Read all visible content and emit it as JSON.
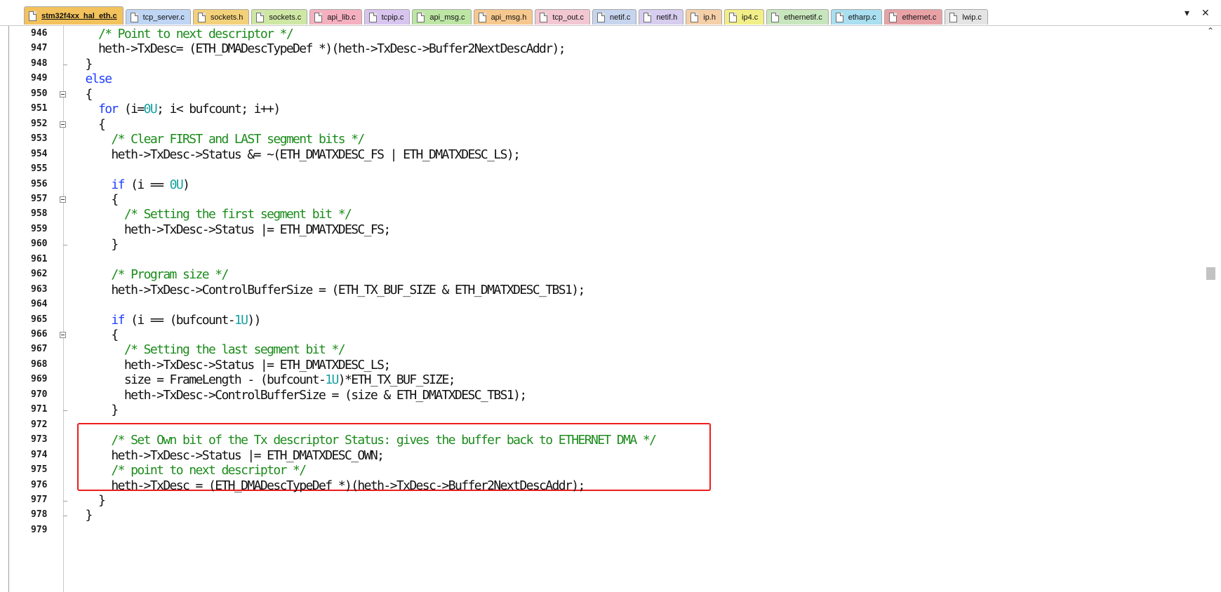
{
  "tabs": [
    {
      "label": "stm32f4xx_hal_eth.c",
      "color": "#f3c25c",
      "active": true
    },
    {
      "label": "tcp_server.c",
      "color": "#bfd5f4"
    },
    {
      "label": "sockets.h",
      "color": "#f3d17a"
    },
    {
      "label": "sockets.c",
      "color": "#cfe7a5"
    },
    {
      "label": "api_lib.c",
      "color": "#f5b0c0"
    },
    {
      "label": "tcpip.c",
      "color": "#d8c5ef"
    },
    {
      "label": "api_msg.c",
      "color": "#bde6a5"
    },
    {
      "label": "api_msg.h",
      "color": "#f6c88e"
    },
    {
      "label": "tcp_out.c",
      "color": "#f2c7d2"
    },
    {
      "label": "netif.c",
      "color": "#c6d4ee"
    },
    {
      "label": "netif.h",
      "color": "#d6cdef"
    },
    {
      "label": "ip.h",
      "color": "#f4cfa7"
    },
    {
      "label": "ip4.c",
      "color": "#f2ef88"
    },
    {
      "label": "ethernetif.c",
      "color": "#c8e6bd"
    },
    {
      "label": "etharp.c",
      "color": "#a9dff0"
    },
    {
      "label": "ethernet.c",
      "color": "#e8a2a6"
    },
    {
      "label": "lwip.c",
      "color": "#e4e4e4"
    }
  ],
  "tab_controls": {
    "dropdown": "▾",
    "close": "✕"
  },
  "scrollbar": {
    "up_arrow": "⌃"
  },
  "lines": [
    {
      "num": "946",
      "fold": "line",
      "tokens": [
        {
          "t": "    "
        },
        {
          "t": "/* Point to next descriptor */",
          "c": "cm"
        }
      ]
    },
    {
      "num": "947",
      "fold": "line",
      "tokens": [
        {
          "t": "    heth->TxDesc= (ETH_DMADescTypeDef *)(heth->TxDesc->Buffer2NextDescAddr);"
        }
      ]
    },
    {
      "num": "948",
      "fold": "tick",
      "tokens": [
        {
          "t": "  }"
        }
      ]
    },
    {
      "num": "949",
      "fold": "line",
      "tokens": [
        {
          "t": "  "
        },
        {
          "t": "else",
          "c": "kw"
        }
      ]
    },
    {
      "num": "950",
      "fold": "box",
      "tokens": [
        {
          "t": "  {"
        }
      ]
    },
    {
      "num": "951",
      "fold": "line",
      "tokens": [
        {
          "t": "    "
        },
        {
          "t": "for",
          "c": "kw"
        },
        {
          "t": " (i="
        },
        {
          "t": "0U",
          "c": "num"
        },
        {
          "t": "; i< bufcount; i++)"
        }
      ]
    },
    {
      "num": "952",
      "fold": "box",
      "tokens": [
        {
          "t": "    {"
        }
      ]
    },
    {
      "num": "953",
      "fold": "line",
      "tokens": [
        {
          "t": "      "
        },
        {
          "t": "/* Clear FIRST and LAST segment bits */",
          "c": "cm"
        }
      ]
    },
    {
      "num": "954",
      "fold": "line",
      "tokens": [
        {
          "t": "      heth->TxDesc->Status &= ~(ETH_DMATXDESC_FS | ETH_DMATXDESC_LS);"
        }
      ]
    },
    {
      "num": "955",
      "fold": "line",
      "tokens": [
        {
          "t": ""
        }
      ]
    },
    {
      "num": "956",
      "fold": "line",
      "tokens": [
        {
          "t": "      "
        },
        {
          "t": "if",
          "c": "kw"
        },
        {
          "t": " (i == "
        },
        {
          "t": "0U",
          "c": "num"
        },
        {
          "t": ")"
        }
      ]
    },
    {
      "num": "957",
      "fold": "box",
      "tokens": [
        {
          "t": "      {"
        }
      ]
    },
    {
      "num": "958",
      "fold": "line",
      "tokens": [
        {
          "t": "        "
        },
        {
          "t": "/* Setting the first segment bit */",
          "c": "cm"
        }
      ]
    },
    {
      "num": "959",
      "fold": "line",
      "tokens": [
        {
          "t": "        heth->TxDesc->Status |= ETH_DMATXDESC_FS;"
        }
      ]
    },
    {
      "num": "960",
      "fold": "tick",
      "tokens": [
        {
          "t": "      }"
        }
      ]
    },
    {
      "num": "961",
      "fold": "line",
      "tokens": [
        {
          "t": ""
        }
      ]
    },
    {
      "num": "962",
      "fold": "line",
      "tokens": [
        {
          "t": "      "
        },
        {
          "t": "/* Program size */",
          "c": "cm"
        }
      ]
    },
    {
      "num": "963",
      "fold": "line",
      "tokens": [
        {
          "t": "      heth->TxDesc->ControlBufferSize = (ETH_TX_BUF_SIZE & ETH_DMATXDESC_TBS1);"
        }
      ]
    },
    {
      "num": "964",
      "fold": "line",
      "tokens": [
        {
          "t": ""
        }
      ]
    },
    {
      "num": "965",
      "fold": "line",
      "tokens": [
        {
          "t": "      "
        },
        {
          "t": "if",
          "c": "kw"
        },
        {
          "t": " (i == (bufcount-"
        },
        {
          "t": "1U",
          "c": "num"
        },
        {
          "t": "))"
        }
      ]
    },
    {
      "num": "966",
      "fold": "box",
      "tokens": [
        {
          "t": "      {"
        }
      ]
    },
    {
      "num": "967",
      "fold": "line",
      "tokens": [
        {
          "t": "        "
        },
        {
          "t": "/* Setting the last segment bit */",
          "c": "cm"
        }
      ]
    },
    {
      "num": "968",
      "fold": "line",
      "tokens": [
        {
          "t": "        heth->TxDesc->Status |= ETH_DMATXDESC_LS;"
        }
      ]
    },
    {
      "num": "969",
      "fold": "line",
      "tokens": [
        {
          "t": "        size = FrameLength - (bufcount-"
        },
        {
          "t": "1U",
          "c": "num"
        },
        {
          "t": ")*ETH_TX_BUF_SIZE;"
        }
      ]
    },
    {
      "num": "970",
      "fold": "line",
      "tokens": [
        {
          "t": "        heth->TxDesc->ControlBufferSize = (size & ETH_DMATXDESC_TBS1);"
        }
      ]
    },
    {
      "num": "971",
      "fold": "tick",
      "tokens": [
        {
          "t": "      }"
        }
      ]
    },
    {
      "num": "972",
      "fold": "line",
      "tokens": [
        {
          "t": ""
        }
      ]
    },
    {
      "num": "973",
      "fold": "line",
      "tokens": [
        {
          "t": "      "
        },
        {
          "t": "/* Set Own bit of the Tx descriptor Status: gives the buffer back to ETHERNET DMA */",
          "c": "cm"
        }
      ]
    },
    {
      "num": "974",
      "fold": "line",
      "tokens": [
        {
          "t": "      heth->TxDesc->Status |= ETH_DMATXDESC_OWN;"
        }
      ]
    },
    {
      "num": "975",
      "fold": "line",
      "tokens": [
        {
          "t": "      "
        },
        {
          "t": "/* point to next descriptor */",
          "c": "cm"
        }
      ]
    },
    {
      "num": "976",
      "fold": "line",
      "tokens": [
        {
          "t": "      heth->TxDesc = (ETH_DMADescTypeDef *)(heth->TxDesc->Buffer2NextDescAddr);"
        }
      ]
    },
    {
      "num": "977",
      "fold": "tick",
      "tokens": [
        {
          "t": "    }"
        }
      ]
    },
    {
      "num": "978",
      "fold": "tick",
      "tokens": [
        {
          "t": "  }"
        }
      ]
    },
    {
      "num": "979",
      "fold": "line",
      "tokens": [
        {
          "t": ""
        }
      ]
    }
  ]
}
